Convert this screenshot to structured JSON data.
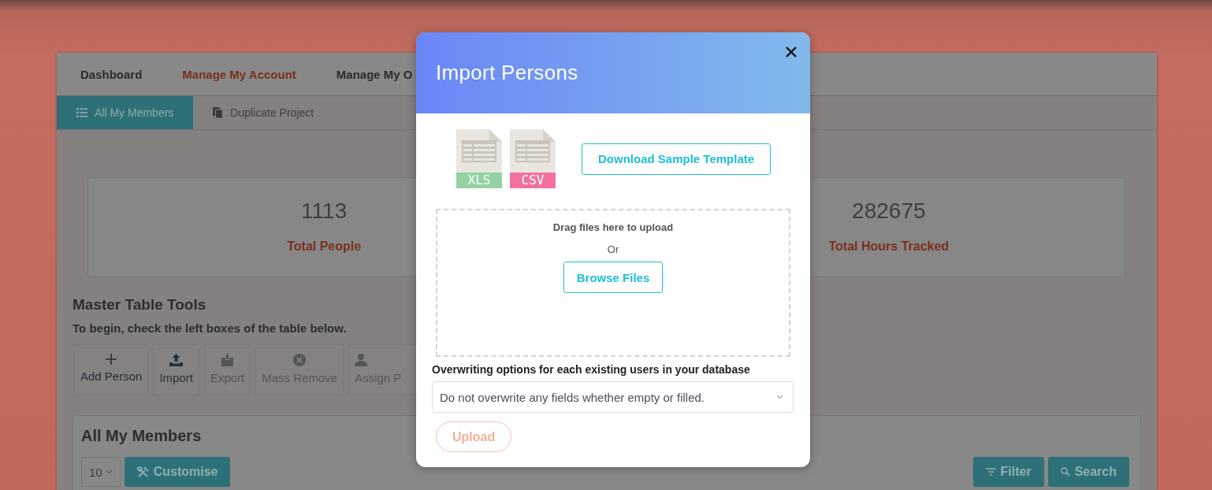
{
  "nav": {
    "items": [
      {
        "label": "Dashboard",
        "selected": false
      },
      {
        "label": "Manage My Account",
        "selected": true
      },
      {
        "label": "Manage My O",
        "selected": false
      }
    ]
  },
  "subtabs": [
    {
      "label": "All My Members",
      "selected": true
    },
    {
      "label": "Duplicate Project",
      "selected": false
    }
  ],
  "stats": [
    {
      "value": "1113",
      "label": "Total People"
    },
    {
      "value": "282675",
      "label": "Total Hours Tracked"
    }
  ],
  "tools": {
    "title": "Master Table Tools",
    "hint": "To begin, check the left boxes of the table below.",
    "buttons": [
      {
        "label": "Add Person",
        "kind": "add",
        "disabled": false
      },
      {
        "label": "Import",
        "kind": "import",
        "disabled": false
      },
      {
        "label": "Export",
        "kind": "export",
        "disabled": true
      },
      {
        "label": "Mass Remove",
        "kind": "remove",
        "disabled": true
      },
      {
        "label": "Assign P",
        "kind": "assign",
        "disabled": true
      }
    ]
  },
  "members": {
    "title": "All My Members",
    "page_size": "10",
    "customise": "Customise",
    "filter": "Filter",
    "search": "Search"
  },
  "modal": {
    "title": "Import Persons",
    "files": [
      {
        "label": "XLS",
        "color": "#94d1a4"
      },
      {
        "label": "CSV",
        "color": "#f2729f"
      }
    ],
    "download_button": "Download Sample Template",
    "dropzone": {
      "text": "Drag files here to upload",
      "separator": "Or",
      "button": "Browse Files"
    },
    "overwrite": {
      "label": "Overwriting options for each existing users in your database",
      "value": "Do not overwrite any fields whether empty or filled."
    },
    "upload_button": {
      "label": "Upload",
      "disabled": true
    }
  }
}
